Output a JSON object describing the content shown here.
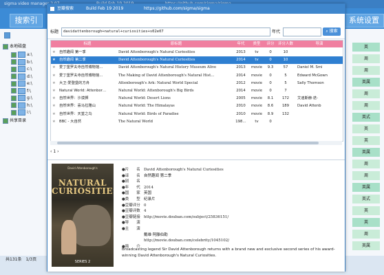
{
  "background_app": {
    "title": "sigma video manager 2.07",
    "build": "Build Feb 19 2019",
    "url": "https://github.com/sigma/sigma",
    "left_tab": "搜索引",
    "right_tab": "系统设置",
    "tree": {
      "root": "本地磁盘",
      "items": [
        "a:\\",
        "b:\\",
        "c:\\",
        "d:\\",
        "e:\\",
        "f:\\",
        "g:\\",
        "h:\\",
        "i:\\"
      ],
      "shared": "共享目录"
    },
    "status": "共131条　1/3页",
    "right_cells": [
      "英",
      "周",
      "周",
      "英属",
      "周",
      "周",
      "英式",
      "英",
      "英",
      "英属",
      "周",
      "周",
      "英属",
      "英式",
      "英",
      "英",
      "周",
      "英属"
    ]
  },
  "dialog": {
    "title": "豆瓣搜索",
    "build": "Build Feb 19 2019",
    "url": "https://github.com/sigma/sigma",
    "search": {
      "title_label": "标题",
      "title_value": "davidattenborough+natural+curiosities+s02e07",
      "year_label": "年代",
      "year_value": "",
      "button": "搜索"
    },
    "columns": [
      "",
      "标题",
      "原标题",
      "年代",
      "类型",
      "评分",
      "评分人数",
      "导演"
    ],
    "rows": [
      {
        "t": "自然趣闻 第一季",
        "o": "David Attenborough's Natural Curiosities",
        "y": "2013",
        "type": "tv",
        "s": "0",
        "n": "10",
        "d": ""
      },
      {
        "t": "自然趣闻 第二季",
        "o": "David Attenborough's Natural Curiosities",
        "y": "2014",
        "type": "tv",
        "s": "0",
        "n": "10",
        "d": ""
      },
      {
        "t": "爱丁堡罗夫寺自然博物馆…",
        "o": "David Attenborough's Natural History Museum Alive",
        "y": "2013",
        "type": "movie",
        "s": "9.3",
        "n": "57",
        "d": "Daniel M. Smi"
      },
      {
        "t": "爱丁堡罗夫寺自然博物馆…",
        "o": "The Making of David Attenborough's Natural Hist…",
        "y": "2014",
        "type": "movie",
        "s": "0",
        "n": "5",
        "d": "Edward McGown"
      },
      {
        "t": "大卫·爱登堡的方舟",
        "o": "Attenborough's Ark: Natural World Special",
        "y": "2012",
        "type": "movie",
        "s": "0",
        "n": "5",
        "d": "Sally Thomson"
      },
      {
        "t": "Natural World: Attenbor…",
        "o": "Natural World: Attenborough's Big Birds",
        "y": "2014",
        "type": "movie",
        "s": "0",
        "n": "7",
        "d": ""
      },
      {
        "t": "自然世界：沙漠狮",
        "o": "Natural World: Desert Lions",
        "y": "2005",
        "type": "movie",
        "s": "8.1",
        "n": "172",
        "d": "艾迪斯赫·迭-"
      },
      {
        "t": "自然世界：喜马拉雅山",
        "o": "Natural World: The Himalayas",
        "y": "2010",
        "type": "movie",
        "s": "8.6",
        "n": "189",
        "d": "David Attenb"
      },
      {
        "t": "自然世界：天堂之鸟",
        "o": "Natural World: Birds of Paradise",
        "y": "2010",
        "type": "movie",
        "s": "8.9",
        "n": "132",
        "d": ""
      },
      {
        "t": "BBC - 大自然",
        "o": "The Natural World",
        "y": "198…",
        "type": "tv",
        "s": "0",
        "n": "",
        "d": ""
      }
    ],
    "pager": "1",
    "detail": {
      "poster_subtitle": "David Attenborough's",
      "poster_title": "NATURAL CURIOSITIES",
      "poster_series": "SERIES 2",
      "fields": [
        {
          "k": "●片　　名",
          "v": "David Attenborough's Natural Curiosities"
        },
        {
          "k": "●译　　名",
          "v": "自然趣闻 第二季"
        },
        {
          "k": "●别　　名",
          "v": ""
        },
        {
          "k": "●年　　代",
          "v": "2014"
        },
        {
          "k": "●国　　家",
          "v": "英国"
        },
        {
          "k": "●类　　型",
          "v": "纪录片"
        },
        {
          "k": "●豆瓣评分",
          "v": "0"
        },
        {
          "k": "●豆瓣评数",
          "v": "4"
        },
        {
          "k": "●豆瓣链接",
          "v": "http://movie.douban.com/subject/25836151/"
        },
        {
          "k": "●导　　演",
          "v": ""
        },
        {
          "k": "●主　　演",
          "v": ""
        },
        {
          "k": "",
          "v": "戴维·阿滕伯勒"
        },
        {
          "k": "",
          "v": "http://movie.douban.com/celebrity/1045102/"
        },
        {
          "k": "●简　　介",
          "v": ""
        }
      ],
      "synopsis": "Broadcasting legend Sir David Attenborough returns with a brand new and exclusive second series of his award-winning David Attenborough's Natural Curiosities."
    }
  }
}
